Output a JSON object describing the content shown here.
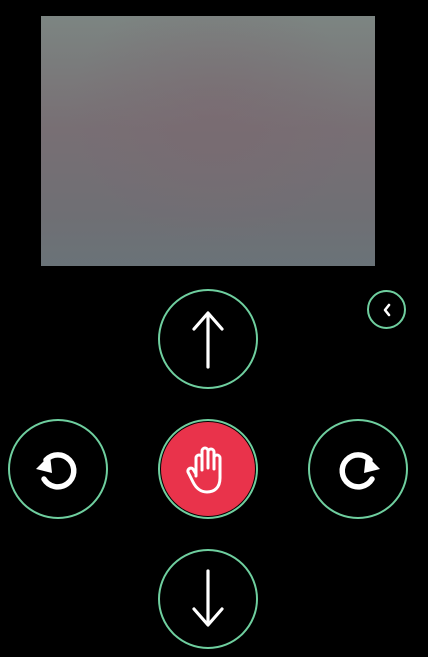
{
  "camera": {
    "icon": "camera-feed"
  },
  "controls": {
    "forward": {
      "icon": "arrow-up-icon"
    },
    "rotate_left": {
      "icon": "rotate-left-icon"
    },
    "stop": {
      "icon": "hand-stop-icon",
      "color": "#e9334b"
    },
    "rotate_right": {
      "icon": "rotate-right-icon"
    },
    "backward": {
      "icon": "arrow-down-icon"
    },
    "collapse": {
      "icon": "chevron-left-icon"
    }
  },
  "colors": {
    "background": "#000000",
    "ring": "#6fcf9f",
    "stop": "#e9334b"
  }
}
